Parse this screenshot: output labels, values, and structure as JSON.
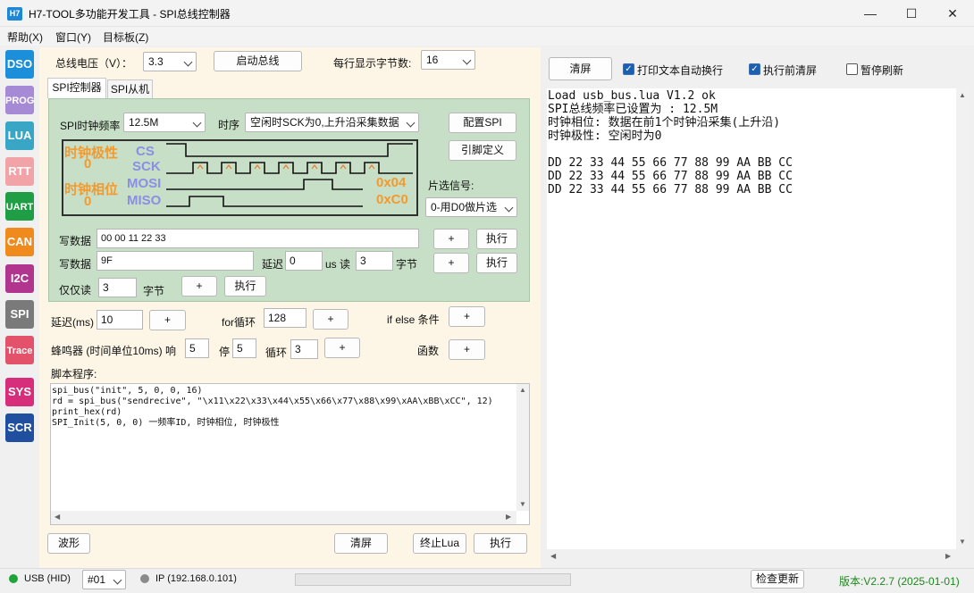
{
  "window": {
    "app_icon": "H7",
    "title": "H7-TOOL多功能开发工具 - SPI总线控制器",
    "minimize": "—",
    "maximize": "☐",
    "close": "✕"
  },
  "menu": [
    "帮助(X)",
    "窗口(Y)",
    "目标板(Z)"
  ],
  "sidebar": [
    {
      "label": "DSO",
      "color": "#1b8fd9"
    },
    {
      "label": "PROG",
      "color": "#a78ad6"
    },
    {
      "label": "LUA",
      "color": "#38a6c4"
    },
    {
      "label": "RTT",
      "color": "#f2a3a8"
    },
    {
      "label": "UART",
      "color": "#1f9e45"
    },
    {
      "label": "CAN",
      "color": "#f08a1c"
    },
    {
      "label": "I2C",
      "color": "#b1358f"
    },
    {
      "label": "SPI",
      "color": "#7a7a7a"
    },
    {
      "label": "Trace",
      "color": "#e2526a"
    },
    {
      "label": "SYS",
      "color": "#d62e7b"
    },
    {
      "label": "SCR",
      "color": "#1f4f9e"
    }
  ],
  "top": {
    "voltage_label": "总线电压（V）：",
    "voltage_value": "3.3",
    "start_bus": "启动总线",
    "bytes_per_line_label": "每行显示字节数:",
    "bytes_per_line_value": "16"
  },
  "tabs": [
    "SPI控制器",
    "SPI从机"
  ],
  "spi": {
    "freq_label": "SPI时钟频率",
    "freq_value": "12.5M",
    "timing_label": "时序",
    "timing_value": "空闲时SCK为0,上升沿采集数据",
    "config_button": "配置SPI",
    "pin_button": "引脚定义",
    "cs_label": "片选信号:",
    "cs_value": "0-用D0做片选",
    "diagram": {
      "cpol_label": "时钟极性",
      "cpol_value": "0",
      "cpha_label": "时钟相位",
      "cpha_value": "0",
      "cs": "CS",
      "sck": "SCK",
      "mosi": "MOSI",
      "miso": "MISO",
      "mosi_value": "0x04",
      "miso_value": "0xC0"
    },
    "row1": {
      "label": "写数据",
      "value": "00 00 11 22 33",
      "plus": "+",
      "exec": "执行"
    },
    "row2": {
      "label": "写数据",
      "value": "9F",
      "delay_label": "延迟",
      "delay_value": "0",
      "us_read": "us 读",
      "read_value": "3",
      "bytes": "字节",
      "plus": "+",
      "exec": "执行"
    },
    "row3": {
      "label": "仅仅读",
      "value": "3",
      "bytes": "字节",
      "plus": "+",
      "exec": "执行"
    }
  },
  "script_tools": {
    "delay_label": "延迟(ms)",
    "delay_value": "10",
    "for_label": "for循环",
    "for_value": "128",
    "ifelse_label": "if else 条件",
    "buzzer_label": "蜂鸣器 (时间单位10ms) 响",
    "buzzer_on": "5",
    "stop_label": "停",
    "stop_value": "5",
    "loop_label": "循环",
    "loop_value": "3",
    "func_label": "函数",
    "plus": "+"
  },
  "script": {
    "label": "脚本程序:",
    "code": "spi_bus(\"init\", 5, 0, 0, 16)\nrd = spi_bus(\"sendrecive\", \"\\x11\\x22\\x33\\x44\\x55\\x66\\x77\\x88\\x99\\xAA\\xBB\\xCC\", 12)\nprint_hex(rd)\nSPI_Init(5, 0, 0) 一频率ID, 时钟相位, 时钟极性"
  },
  "bottom_buttons": {
    "waveform": "波形",
    "clear": "清屏",
    "stop_lua": "终止Lua",
    "run": "执行"
  },
  "right": {
    "clear_button": "清屏",
    "wrap_label": "打印文本自动换行",
    "clear_before_label": "执行前清屏",
    "pause_label": "暂停刷新",
    "output": "Load usb_bus.lua V1.2 ok\nSPI总线频率已设置为 : 12.5M\n时钟相位: 数据在前1个时钟沿采集(上升沿)\n时钟极性: 空闲时为0\n\nDD 22 33 44 55 66 77 88 99 AA BB CC\nDD 22 33 44 55 66 77 88 99 AA BB CC\nDD 22 33 44 55 66 77 88 99 AA BB CC"
  },
  "status": {
    "usb": "USB (HID)",
    "port": "#01",
    "ip": "IP (192.168.0.101)",
    "check_update": "检查更新",
    "version": "版本:V2.2.7 (2025-01-01)"
  }
}
